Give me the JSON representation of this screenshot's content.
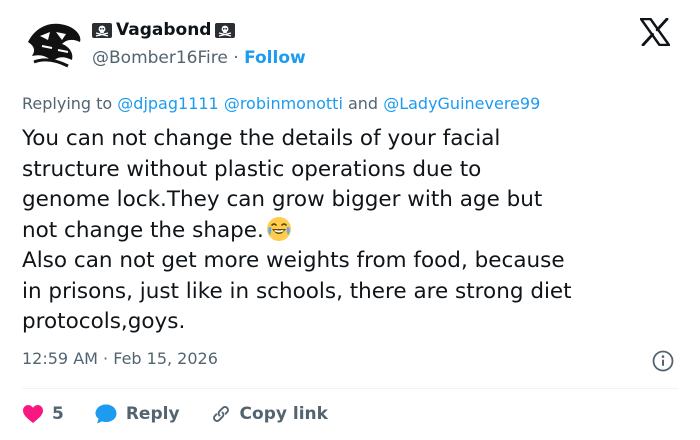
{
  "user": {
    "display_name": "Vagabond",
    "handle": "@Bomber16Fire",
    "separator": "·",
    "follow_label": "Follow",
    "flag_icon": "pirate-flag-icon",
    "avatar_icon": "eagle-sketch-avatar"
  },
  "brand": {
    "logo": "x-logo-icon"
  },
  "reply_to": {
    "prefix": "Replying to",
    "mention_1": "@djpag1111",
    "mention_2": "@robinmonotti",
    "conjunction": "and",
    "mention_3": "@LadyGuinevere99"
  },
  "tweet": {
    "lines": [
      "You can not change the details of your facial",
      "structure without plastic operations due to",
      "genome lock.They can grow bigger with age but",
      "not change the shape.",
      "Also can not get more weights from food, because",
      "in prisons, just like in schools, there are strong diet",
      "protocols,goys."
    ],
    "emoji": "laughing-tears-emoji"
  },
  "meta": {
    "time": "12:59 AM",
    "separator": "·",
    "date": "Feb 15, 2026"
  },
  "actions": {
    "like_count": "5",
    "reply_label": "Reply",
    "copy_link_label": "Copy link"
  },
  "colors": {
    "accent": "#1d9bf0",
    "like": "#f91880",
    "text": "#0f1419",
    "muted": "#536471",
    "divider": "#eff3f4"
  }
}
